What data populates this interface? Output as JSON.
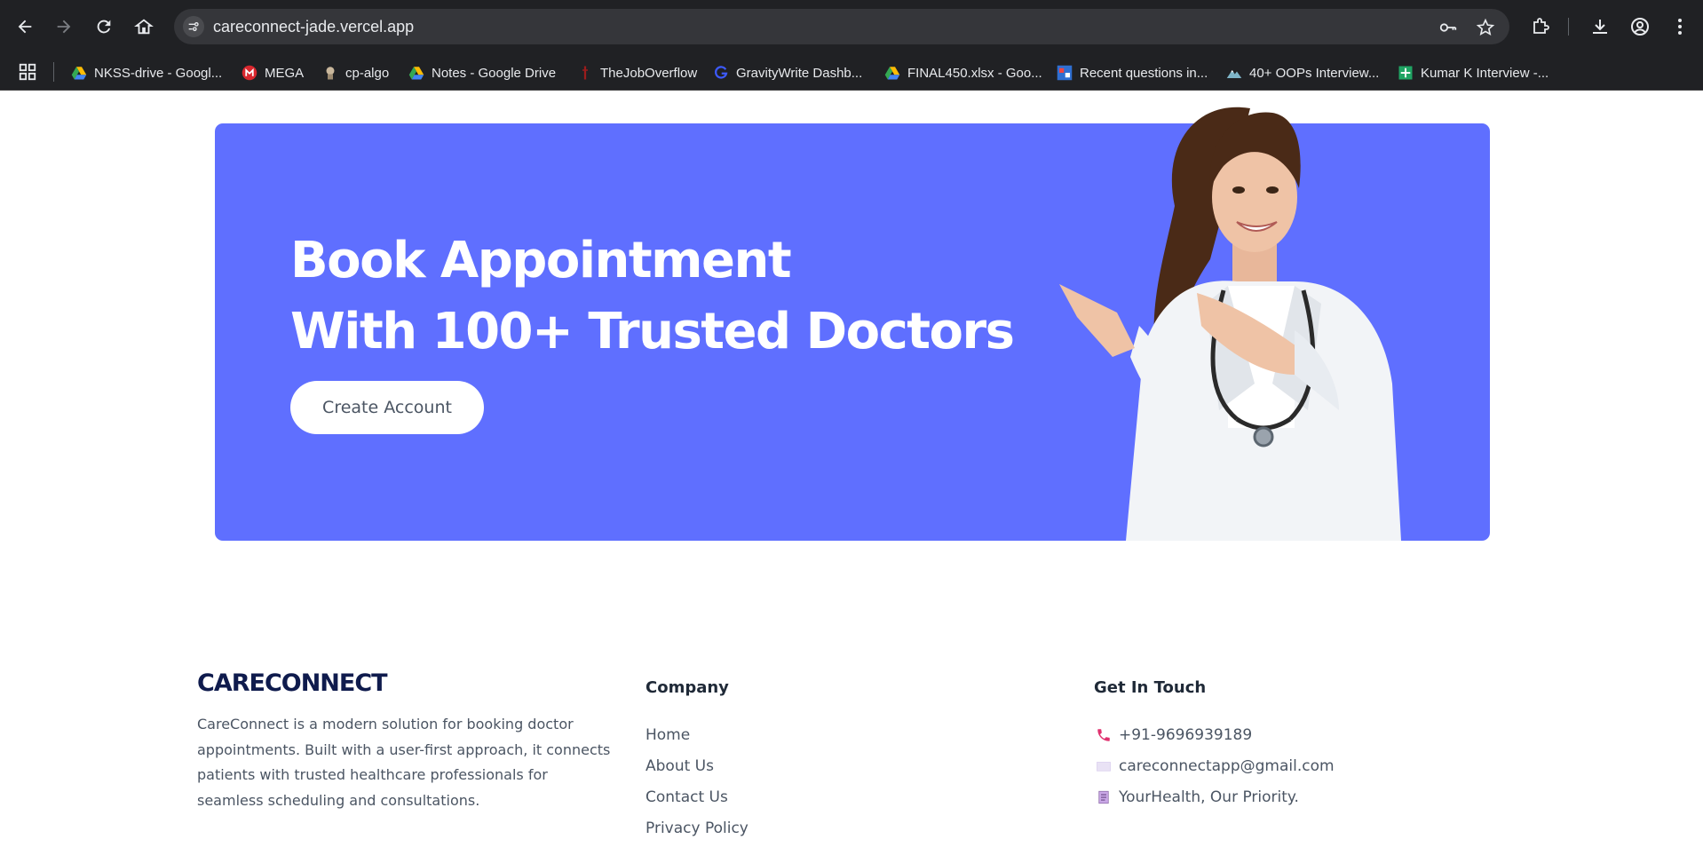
{
  "browser": {
    "url": "careconnect-jade.vercel.app",
    "bookmarks": [
      {
        "label": "NKSS-drive - Googl...",
        "icon": "google-drive-icon"
      },
      {
        "label": "MEGA",
        "icon": "mega-icon"
      },
      {
        "label": "cp-algo",
        "icon": "cp-algo-icon"
      },
      {
        "label": "Notes - Google Drive",
        "icon": "google-drive-icon"
      },
      {
        "label": "TheJobOverflow",
        "icon": "job-overflow-icon"
      },
      {
        "label": "GravityWrite Dashb...",
        "icon": "gravitywrite-icon"
      },
      {
        "label": "FINAL450.xlsx - Goo...",
        "icon": "google-drive-icon"
      },
      {
        "label": "Recent questions in...",
        "icon": "questions-icon"
      },
      {
        "label": "40+ OOPs Interview...",
        "icon": "mountain-icon"
      },
      {
        "label": "Kumar K Interview -...",
        "icon": "google-sheets-icon"
      }
    ]
  },
  "banner": {
    "headline_line1": "Book Appointment",
    "headline_line2": "With 100+ Trusted Doctors",
    "cta_label": "Create Account",
    "accent_color": "#5f6fff"
  },
  "footer": {
    "logo": "CARECONNECT",
    "about": "CareConnect is a modern solution for booking doctor appointments. Built with a user-first approach, it connects patients with trusted healthcare professionals for seamless scheduling and consultations.",
    "company": {
      "title": "Company",
      "links": [
        "Home",
        "About Us",
        "Contact Us",
        "Privacy Policy"
      ]
    },
    "contact": {
      "title": "Get In Touch",
      "phone": "+91-9696939189",
      "email": "careconnectapp@gmail.com",
      "tagline": "YourHealth, Our Priority."
    }
  }
}
